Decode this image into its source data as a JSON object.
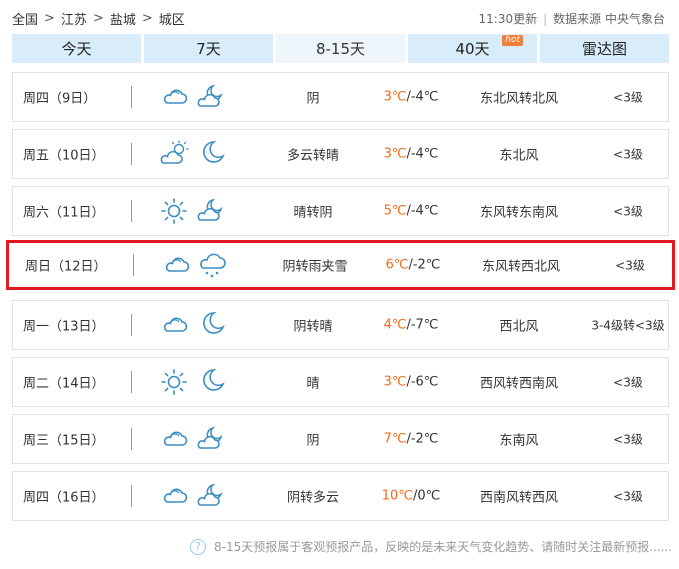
{
  "breadcrumb": [
    "全国",
    "江苏",
    "盐城",
    "城区"
  ],
  "meta": {
    "update": "11:30更新",
    "source": "数据来源 中央气象台"
  },
  "tabs": [
    {
      "label": "今天"
    },
    {
      "label": "7天"
    },
    {
      "label": "8-15天",
      "active": true
    },
    {
      "label": "40天",
      "badge": "hot"
    },
    {
      "label": "雷达图"
    }
  ],
  "rows": [
    {
      "day": "周四（9日）",
      "icon_day": "cloudy-icon",
      "icon_night": "partly-cloudy-night-icon",
      "desc": "阴",
      "hi": "3℃",
      "lo": "/-4℃",
      "wind": "东北风转北风",
      "level": "<3级"
    },
    {
      "day": "周五（10日）",
      "icon_day": "partly-cloudy-day-icon",
      "icon_night": "moon-icon",
      "desc": "多云转晴",
      "hi": "3℃",
      "lo": "/-4℃",
      "wind": "东北风",
      "level": "<3级"
    },
    {
      "day": "周六（11日）",
      "icon_day": "sun-icon",
      "icon_night": "partly-cloudy-night-icon",
      "desc": "晴转阴",
      "hi": "5℃",
      "lo": "/-4℃",
      "wind": "东风转东南风",
      "level": "<3级"
    },
    {
      "day": "周日（12日）",
      "icon_day": "cloudy-icon",
      "icon_night": "sleet-icon",
      "desc": "阴转雨夹雪",
      "hi": "6℃",
      "lo": "/-2℃",
      "wind": "东风转西北风",
      "level": "<3级",
      "highlight": true
    },
    {
      "day": "周一（13日）",
      "icon_day": "cloudy-icon",
      "icon_night": "moon-icon",
      "desc": "阴转晴",
      "hi": "4℃",
      "lo": "/-7℃",
      "wind": "西北风",
      "level": "3-4级转<3级"
    },
    {
      "day": "周二（14日）",
      "icon_day": "sun-icon",
      "icon_night": "moon-icon",
      "desc": "晴",
      "hi": "3℃",
      "lo": "/-6℃",
      "wind": "西风转西南风",
      "level": "<3级"
    },
    {
      "day": "周三（15日）",
      "icon_day": "cloudy-icon",
      "icon_night": "partly-cloudy-night-icon",
      "desc": "阴",
      "hi": "7℃",
      "lo": "/-2℃",
      "wind": "东南风",
      "level": "<3级"
    },
    {
      "day": "周四（16日）",
      "icon_day": "cloudy-icon",
      "icon_night": "partly-cloudy-night-icon",
      "desc": "阴转多云",
      "hi": "10℃",
      "lo": "/0℃",
      "wind": "西南风转西风",
      "level": "<3级"
    }
  ],
  "footer": {
    "text": "8-15天预报属于客观预报产品，反映的是未来天气变化趋势、请随时关注最新预报......"
  },
  "colors": {
    "accent": "#f26b1d",
    "tab_bg": "#d9ecf9",
    "highlight": "#e01a22",
    "icon_stroke": "#3b8ec2"
  }
}
